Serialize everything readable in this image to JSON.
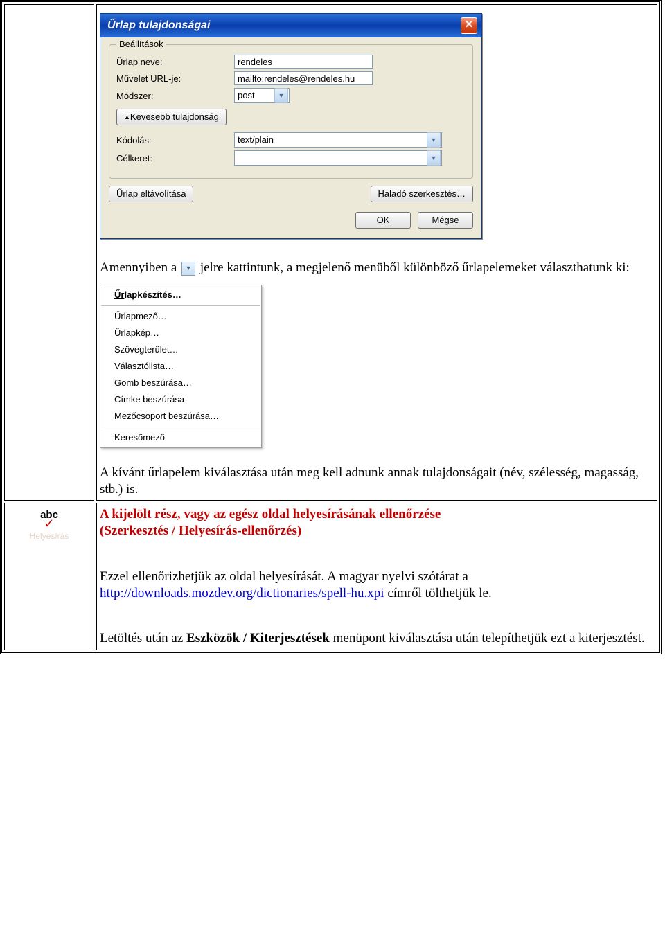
{
  "dialog": {
    "title": "Űrlap tulajdonságai",
    "close_symbol": "✕",
    "group_legend": "Beállítások",
    "labels": {
      "name": "Űrlap neve:",
      "action": "Művelet URL-je:",
      "method": "Módszer:",
      "encoding": "Kódolás:",
      "target": "Célkeret:"
    },
    "values": {
      "name": "rendeles",
      "action": "mailto:rendeles@rendeles.hu",
      "method": "post",
      "encoding": "text/plain",
      "target": ""
    },
    "buttons": {
      "fewer_props": "Kevesebb tulajdonság",
      "remove_form": "Űrlap eltávolítása",
      "advanced_edit": "Haladó szerkesztés…",
      "ok": "OK",
      "cancel": "Mégse"
    }
  },
  "paragraphs": {
    "p1_a": "Amennyiben a ",
    "p1_b": " jelre kattintunk, a megjelenő menüből különböző űrlapelemeket választhatunk ki:",
    "p2": "A kívánt űrlapelem kiválasztása után meg kell adnunk annak tulajdonságait (név, szélesség, magasság, stb.) is."
  },
  "menu": {
    "item0": "Űrlapkészítés…",
    "item1": "Űrlapmező…",
    "item2": "Űrlapkép…",
    "item3": "Szövegterület…",
    "item4": "Választólista…",
    "item5": "Gomb beszúrása…",
    "item6": "Címke beszúrása",
    "item7": "Mezőcsoport beszúrása…",
    "item8": "Keresőmező"
  },
  "row2": {
    "icon_abc": "abc",
    "icon_check": "✓",
    "icon_label": "Helyesírás",
    "heading": "A kijelölt rész, vagy az egész oldal helyesírásának ellenőrzése",
    "heading_sub": "(Szerkesztés / Helyesírás-ellenőrzés)",
    "p1": "Ezzel ellenőrizhetjük az oldal helyesírását. A magyar nyelvi szótárat a ",
    "link": "http://downloads.mozdev.org/dictionaries/spell-hu.xpi",
    "p1_after": " címről tölthetjük le.",
    "p2_a": "Letöltés után az ",
    "p2_bold": "Eszközök / Kiterjesztések",
    "p2_b": " menüpont kiválasztása után telepíthetjük ezt a kiterjesztést."
  }
}
